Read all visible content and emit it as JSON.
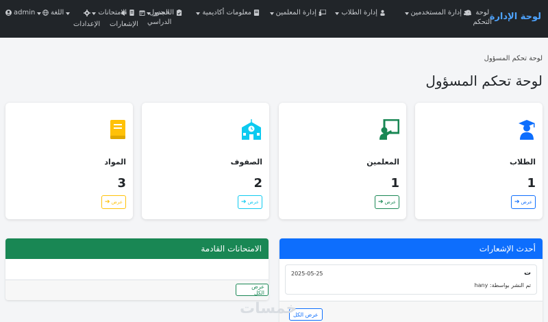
{
  "navbar": {
    "brand": "لوحة الإدارة",
    "items": [
      {
        "label": "لوحة التحكم",
        "icon": "dashboard-icon"
      },
      {
        "label": "إدارة المستخدمين",
        "icon": "users-icon"
      },
      {
        "label": "إدارة الطلاب",
        "icon": "student-icon"
      },
      {
        "label": "إدارة المعلمين",
        "icon": "teacher-icon"
      },
      {
        "label": "معلومات أكاديمية",
        "icon": "academic-icon"
      },
      {
        "label": "الحضور",
        "icon": "attendance-icon"
      },
      {
        "label": "الامتحانات",
        "icon": "exams-icon"
      },
      {
        "label": "الجدول الدراسي",
        "icon": "calendar-icon"
      },
      {
        "label": "الإشعارات",
        "icon": "megaphone-icon"
      },
      {
        "label": "الإعدادات",
        "icon": "gear-icon"
      },
      {
        "label": "اللغة",
        "icon": "globe-icon"
      },
      {
        "label": "admin",
        "icon": "user-circle-icon"
      }
    ],
    "table_line1": "الجدول",
    "table_line2": "الدراسي",
    "dashboard_line1": "لوحة",
    "dashboard_line2": "التحكم"
  },
  "breadcrumb": "لوحة تحكم المسؤول",
  "page_title": "لوحة تحكم المسؤول",
  "cards": [
    {
      "label": "الطلاب",
      "count": "1",
      "button": "عرض",
      "color": "#0d6efd",
      "icon": "graduate-icon"
    },
    {
      "label": "المعلمين",
      "count": "1",
      "button": "عرض",
      "color": "#198754",
      "icon": "teacher-board-icon"
    },
    {
      "label": "الصفوف",
      "count": "2",
      "button": "عرض",
      "color": "#0dcaf0",
      "icon": "school-icon"
    },
    {
      "label": "المواد",
      "count": "3",
      "button": "عرض",
      "color": "#ffc107",
      "icon": "book-icon"
    }
  ],
  "notifications_panel": {
    "title": "أحدث الإشعارات",
    "color": "#0d6efd",
    "items": [
      {
        "title": "ت",
        "date": "2025-05-25",
        "by": "تم النشر بواسطة: hany"
      }
    ],
    "button": "عرض الكل"
  },
  "exams_panel": {
    "title": "الامتحانات القادمة",
    "color": "#198754",
    "button": "عرض الكل"
  },
  "watermark": "خمسات"
}
